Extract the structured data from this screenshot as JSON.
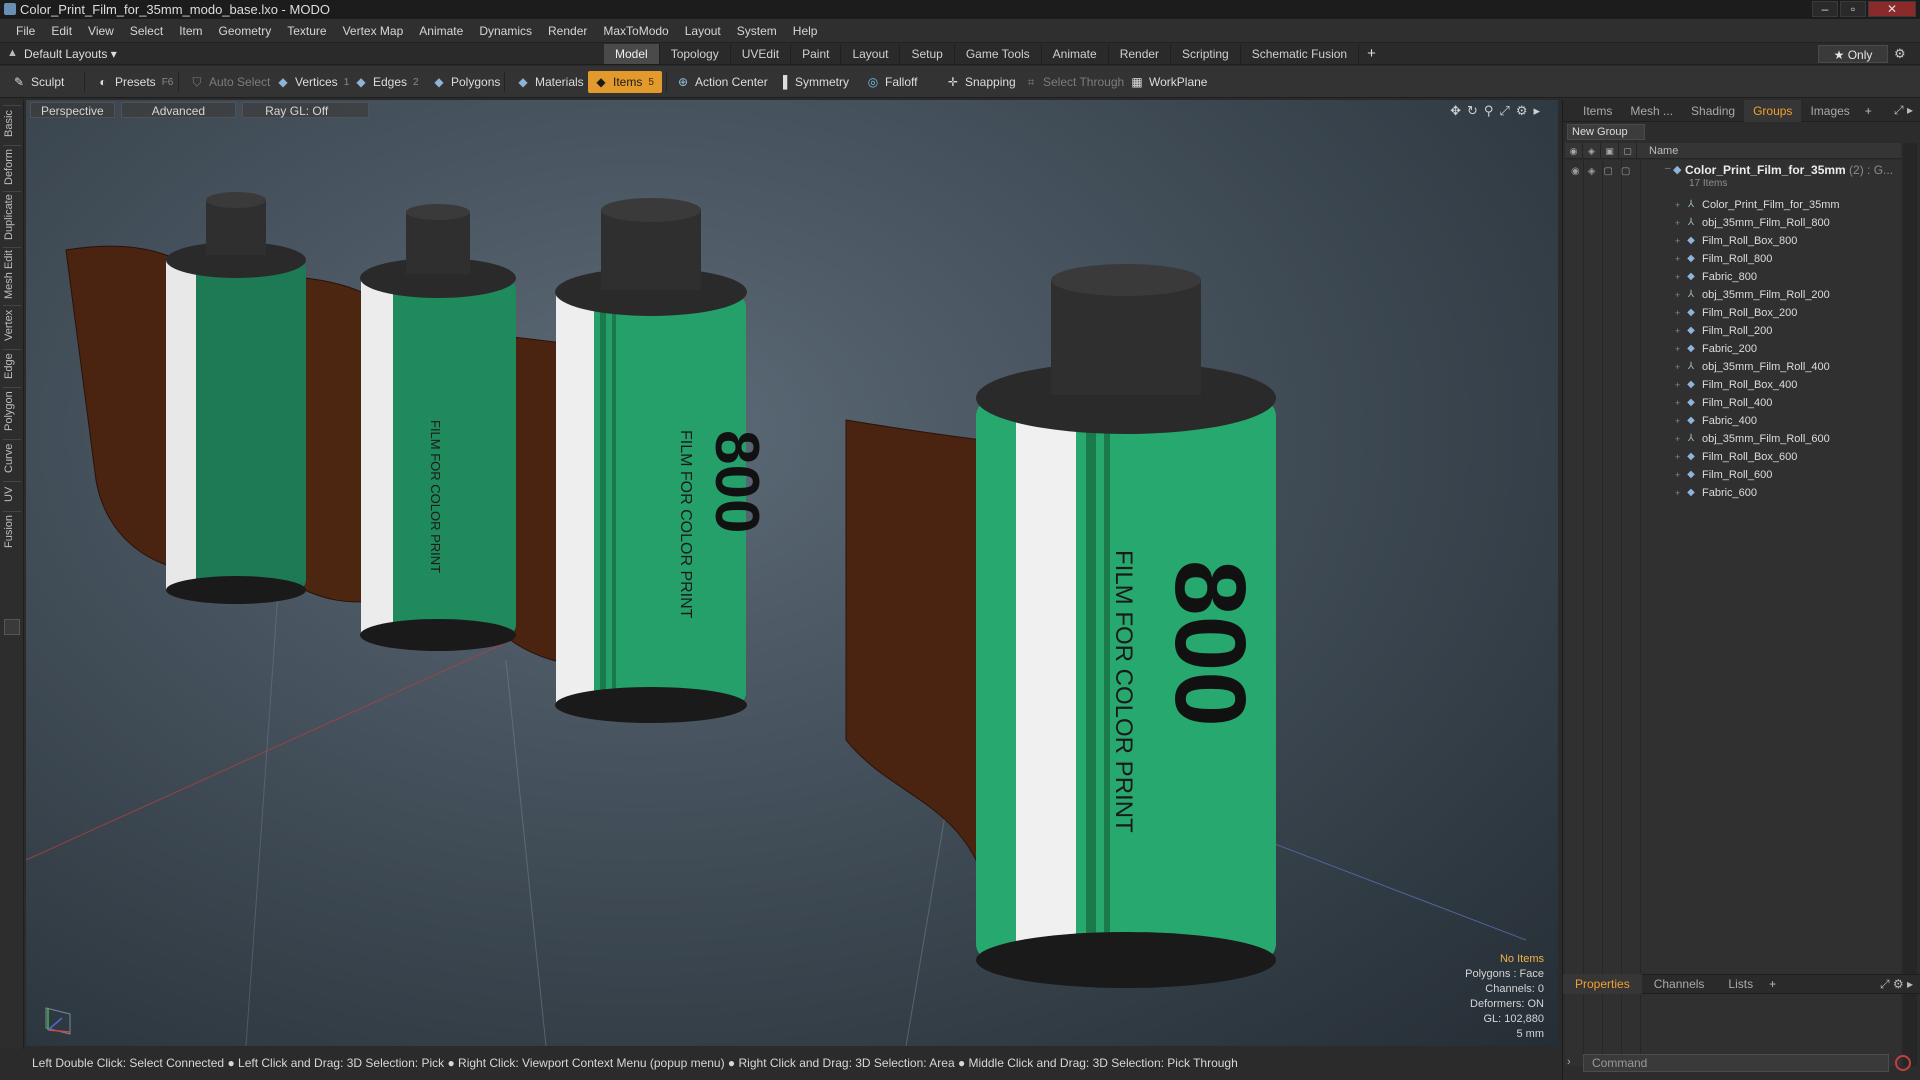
{
  "window": {
    "title": "Color_Print_Film_for_35mm_modo_base.lxo - MODO",
    "controls": [
      "–",
      "▫",
      "✕"
    ]
  },
  "menu": [
    "File",
    "Edit",
    "View",
    "Select",
    "Item",
    "Geometry",
    "Texture",
    "Vertex Map",
    "Animate",
    "Dynamics",
    "Render",
    "MaxToModo",
    "Layout",
    "System",
    "Help"
  ],
  "layoutbar": {
    "layout_dropdown": "Default Layouts ▾",
    "tabs": [
      "Model",
      "Topology",
      "UVEdit",
      "Paint",
      "Layout",
      "Setup",
      "Game Tools",
      "Animate",
      "Render",
      "Scripting",
      "Schematic Fusion"
    ],
    "active_tab": "Model",
    "only_label": "★  Only"
  },
  "toolbar": {
    "sculpt": "Sculpt",
    "presets": "Presets",
    "presets_key": "F6",
    "auto_select": "Auto Select",
    "vertices": "Vertices",
    "vertices_key": "1",
    "edges": "Edges",
    "edges_key": "2",
    "polygons": "Polygons",
    "materials": "Materials",
    "items": "Items",
    "items_key": "5",
    "action_center": "Action Center",
    "symmetry": "Symmetry",
    "falloff": "Falloff",
    "snapping": "Snapping",
    "select_through": "Select Through",
    "workplane": "WorkPlane"
  },
  "left_tabs": [
    "Basic",
    "Deform",
    "Duplicate",
    "Mesh Edit",
    "Vertex",
    "Edge",
    "Polygon",
    "Curve",
    "UV",
    "Fusion"
  ],
  "viewport": {
    "view_mode": "Perspective",
    "shading": "Advanced",
    "raygl": "Ray GL: Off",
    "stats": {
      "selection": "No Items",
      "polygons": "Polygons : Face",
      "channels": "Channels: 0",
      "deformers": "Deformers: ON",
      "gl": "GL: 102,880",
      "scale": "5 mm"
    },
    "label_text": "FILM FOR COLOR PRINT",
    "label_number": "800"
  },
  "status_bar": "Left Double Click: Select Connected ● Left Click and Drag: 3D Selection: Pick ● Right Click: Viewport Context Menu (popup menu) ● Right Click and Drag: 3D Selection: Area ● Middle Click and Drag: 3D Selection: Pick Through",
  "right_panel": {
    "tabs": [
      "Items",
      "Mesh ...",
      "Shading",
      "Groups",
      "Images"
    ],
    "active_tab": "Groups",
    "new_group": "New Group",
    "column_name": "Name",
    "group": {
      "title": "Color_Print_Film_for_35mm",
      "suffix": " (2) : G...",
      "count": "17 Items"
    },
    "items": [
      {
        "name": "Color_Print_Film_for_35mm",
        "kind": "loc"
      },
      {
        "name": "obj_35mm_Film_Roll_800",
        "kind": "loc"
      },
      {
        "name": "Film_Roll_Box_800",
        "kind": "mesh"
      },
      {
        "name": "Film_Roll_800",
        "kind": "mesh"
      },
      {
        "name": "Fabric_800",
        "kind": "mesh"
      },
      {
        "name": "obj_35mm_Film_Roll_200",
        "kind": "loc"
      },
      {
        "name": "Film_Roll_Box_200",
        "kind": "mesh"
      },
      {
        "name": "Film_Roll_200",
        "kind": "mesh"
      },
      {
        "name": "Fabric_200",
        "kind": "mesh"
      },
      {
        "name": "obj_35mm_Film_Roll_400",
        "kind": "loc"
      },
      {
        "name": "Film_Roll_Box_400",
        "kind": "mesh"
      },
      {
        "name": "Film_Roll_400",
        "kind": "mesh"
      },
      {
        "name": "Fabric_400",
        "kind": "mesh"
      },
      {
        "name": "obj_35mm_Film_Roll_600",
        "kind": "loc"
      },
      {
        "name": "Film_Roll_Box_600",
        "kind": "mesh"
      },
      {
        "name": "Film_Roll_600",
        "kind": "mesh"
      },
      {
        "name": "Fabric_600",
        "kind": "mesh"
      }
    ],
    "bottom_tabs": [
      "Properties",
      "Channels",
      "Lists"
    ],
    "bottom_active": "Properties",
    "command_placeholder": "Command"
  }
}
